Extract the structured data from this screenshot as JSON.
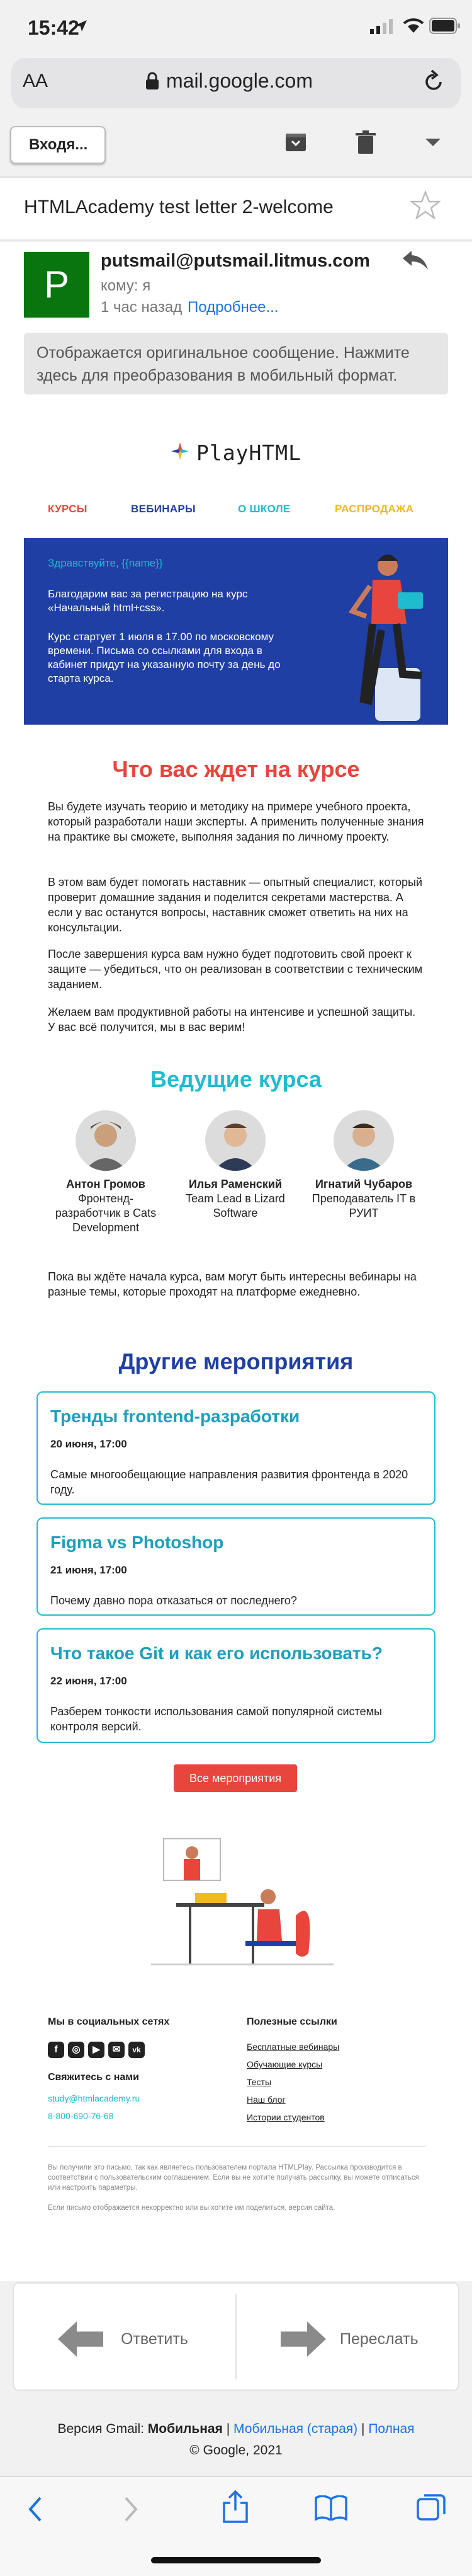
{
  "status_bar": {
    "time": "15:42"
  },
  "browser": {
    "url": "mail.google.com",
    "text_size": "AA"
  },
  "gmail": {
    "back_label": "Входя...",
    "subject": "HTMLAcademy test letter 2-welcome",
    "sender_initial": "P",
    "from": "putsmail@putsmail.litmus.com",
    "to": "кому: я",
    "time_ago": "1 час назад",
    "details_link": "Подробнее...",
    "notice": "Отображается оригинальное сообщение. Нажмите здесь для преобразования в мобильный формат.",
    "reply_label": "Ответить",
    "forward_label": "Переслать",
    "version_prefix": "Версия Gmail:",
    "version_mobile": "Мобильная",
    "version_sep1": "|",
    "version_old": "Мобильная (старая)",
    "version_sep2": "|",
    "version_full": "Полная",
    "copyright": "© Google, 2021"
  },
  "email": {
    "logo": "PlayHTML",
    "nav": [
      {
        "label": "КУРСЫ",
        "color": "#e8453c"
      },
      {
        "label": "ВЕБИНАРЫ",
        "color": "#1f3fa4"
      },
      {
        "label": "О ШКОЛЕ",
        "color": "#1fbcd0"
      },
      {
        "label": "РАСПРОДАЖА",
        "color": "#f2b824"
      }
    ],
    "hero": {
      "greeting": "Здравствуйте, {{name}}",
      "line1": "Благодарим вас за регистрацию на курс «Начальный html+css».",
      "line2": "Курс стартует 1 июля в 17.00 по московскому времени. Письма со ссылками для входа в кабинет придут на указанную почту за день до старта курса."
    },
    "expect": {
      "title": "Что вас ждет на курсе",
      "p1": "Вы будете изучать теорию и методику на примере учебного проекта, который разработали наши эксперты. А применить полученные знания на практике вы сможете, выполняя задания по личному проекту.",
      "p2": "В этом вам будет помогать наставник — опытный специалист, который проверит домашние задания и поделится секретами мастерства. А если у вас останутся вопросы, наставник сможет ответить на них на консультации.",
      "p3": "После завершения курса вам нужно будет подготовить свой проект к защите — убедиться, что он реализован в соответствии с техническим заданием.",
      "p4": "Желаем вам продуктивной работы на интенсиве и успешной защиты. У вас всё получится, мы в вас верим!"
    },
    "teachers_title": "Ведущие курса",
    "teachers": [
      {
        "name": "Антон Громов",
        "role": "Фронтенд-разработчик в Cats Development"
      },
      {
        "name": "Илья Раменский",
        "role": "Team Lead в Lizard Software"
      },
      {
        "name": "Игнатий Чубаров",
        "role": "Преподаватель IT в РУИТ"
      }
    ],
    "waiting_text": "Пока вы ждёте начала курса, вам могут быть интересны вебинары на разные темы, которые проходят на платформе ежедневно.",
    "events_title": "Другие мероприятия",
    "events": [
      {
        "title": "Тренды frontend-разработки",
        "date": "20 июня, 17:00",
        "desc": "Самые многообещающие направления развития фронтенда в 2020 году."
      },
      {
        "title": "Figma vs Photoshop",
        "date": "21 июня, 17:00",
        "desc": "Почему давно пора отказаться от последнего?"
      },
      {
        "title": "Что такое Git и как его использовать?",
        "date": "22 июня, 17:00",
        "desc": "Разберем тонкости использования самой популярной системы контроля версий."
      }
    ],
    "all_events_label": "Все мероприятия",
    "footer": {
      "social_title": "Мы в социальных сетях",
      "social_icons": [
        "f",
        "◎",
        "▶",
        "✉",
        "vk"
      ],
      "contact_title": "Свяжитесь с нами",
      "email": "study@htmlacademy.ru",
      "phone": "8-800-690-76-68",
      "links_title": "Полезные ссылки",
      "links": [
        "Бесплатные вебинары",
        "Обучающие курсы",
        "Тесты",
        "Наш блог",
        "Истории студентов"
      ],
      "disclaimer": "Вы получили это письмо, так как являетесь пользователем портала HTMLPlay. Рассылка производится в соответствии с пользовательским соглашением. Если вы не хотите получать рассылку, вы можете отписаться или настроить параметры.",
      "disclaimer2": "Если письмо отображается некорректно или вы хотите им поделиться, версия сайта."
    }
  }
}
